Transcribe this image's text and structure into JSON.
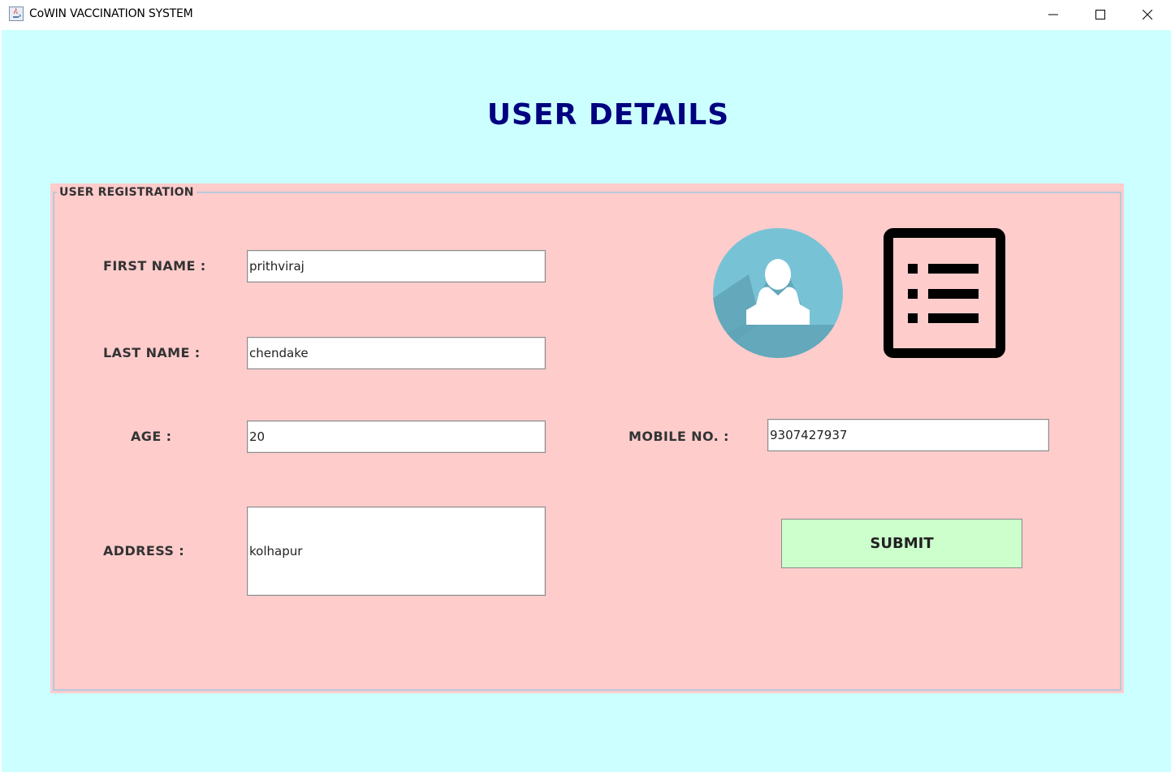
{
  "window": {
    "title": "CoWIN VACCINATION SYSTEM",
    "controls": [
      "minimize",
      "maximize",
      "close"
    ]
  },
  "heading": "USER DETAILS",
  "registration": {
    "legend": "USER REGISTRATION",
    "first_name": {
      "label": "FIRST NAME :",
      "value": "prithviraj"
    },
    "last_name": {
      "label": "LAST NAME :",
      "value": "chendake"
    },
    "age": {
      "label": "AGE :",
      "value": "20"
    },
    "mobile": {
      "label": "MOBILE NO. :",
      "value": "9307427937"
    },
    "address": {
      "label": "ADDRESS  :",
      "value": "kolhapur"
    },
    "submit_label": "SUBMIT"
  },
  "icons": {
    "app": "java-app-icon",
    "avatar": "user-avatar-icon",
    "list": "list-document-icon"
  },
  "colors": {
    "background": "#ccffff",
    "panel": "#ffcccc",
    "heading": "#000080",
    "submit": "#ccffcc",
    "avatar_circle": "#78c2d6"
  }
}
